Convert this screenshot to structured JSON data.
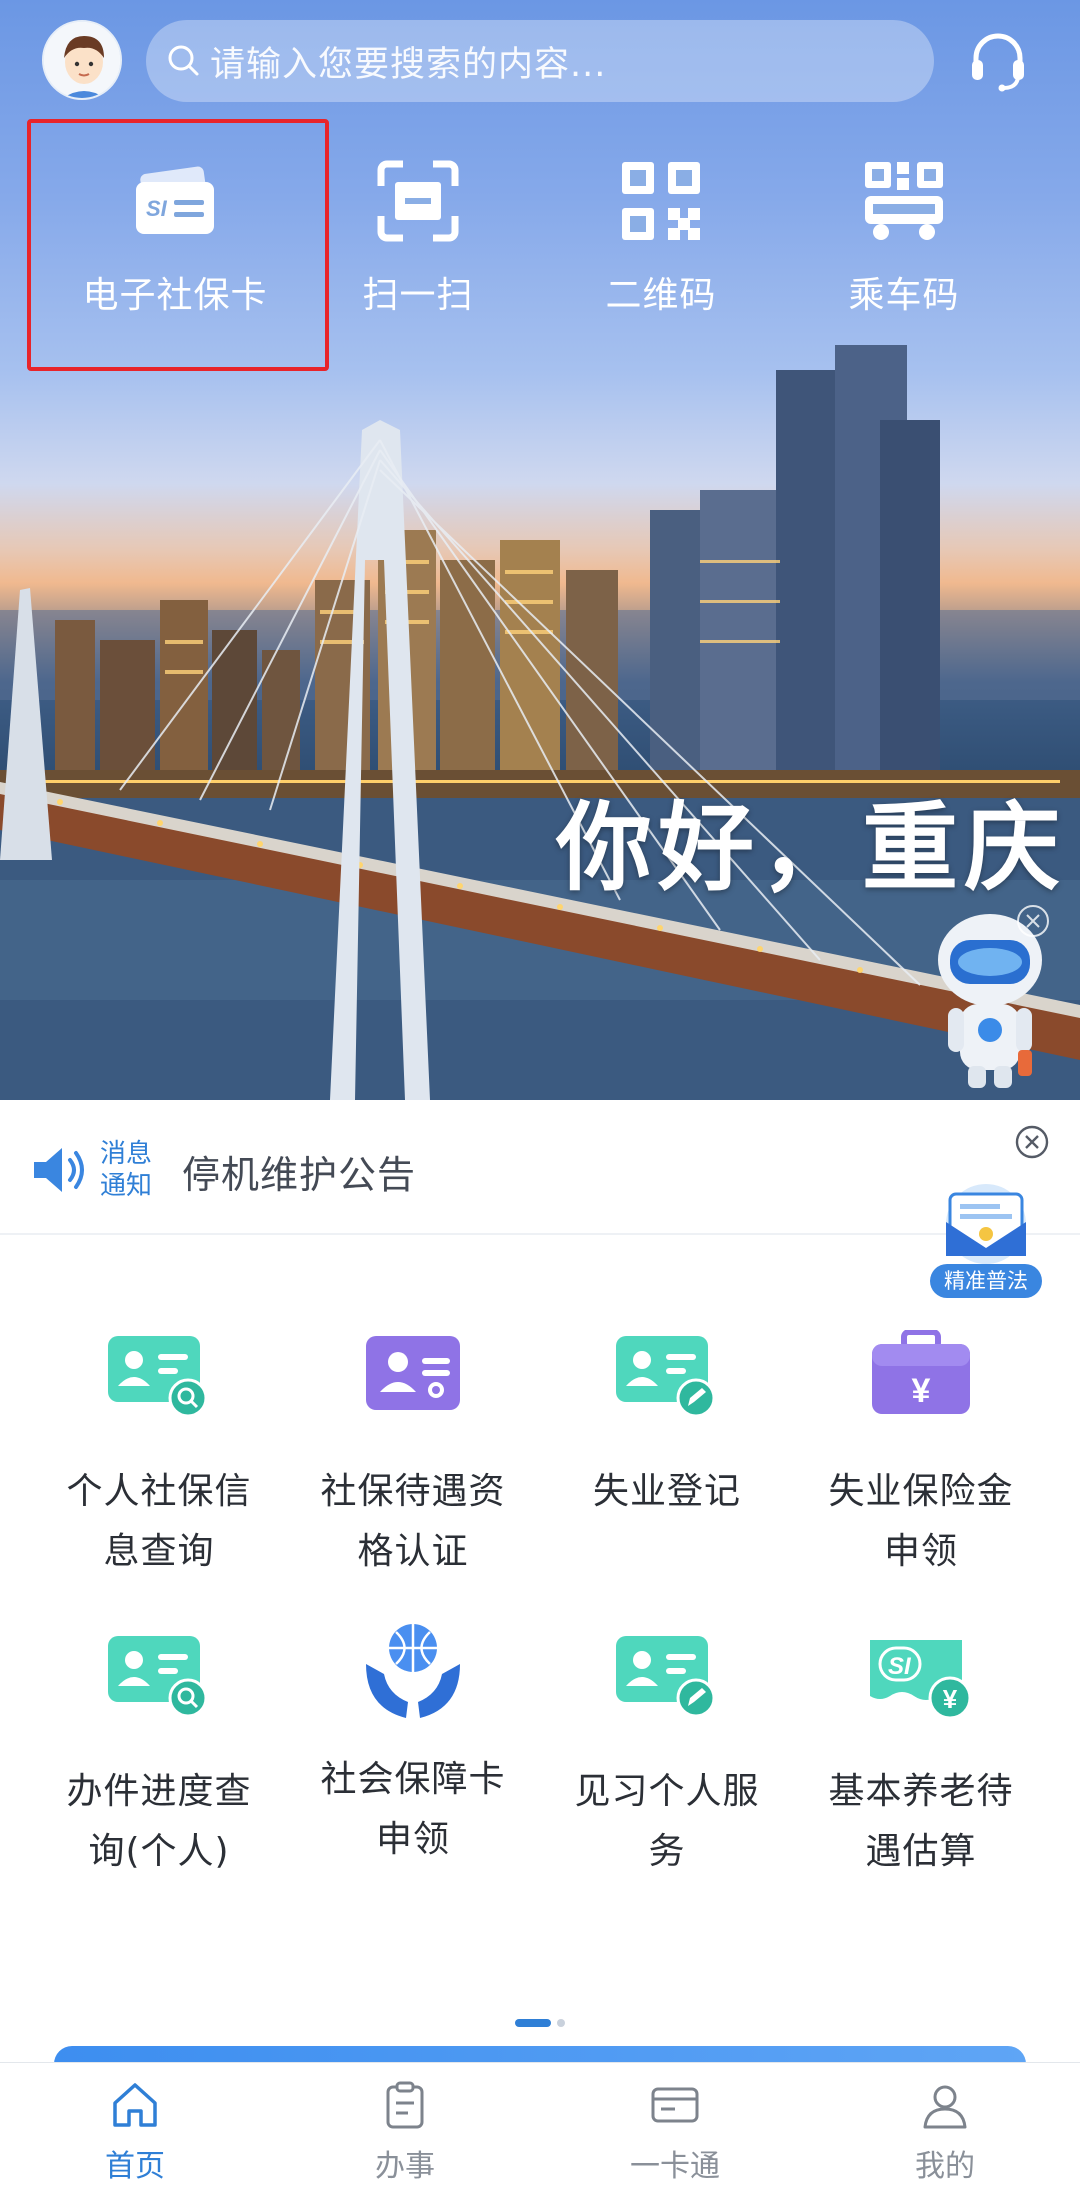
{
  "search": {
    "placeholder": "请输入您要搜索的内容..."
  },
  "quick_actions": [
    {
      "label": "电子社保卡",
      "icon": "social-security-card-icon",
      "highlighted": true
    },
    {
      "label": "扫一扫",
      "icon": "scan-icon"
    },
    {
      "label": "二维码",
      "icon": "qr-code-icon"
    },
    {
      "label": "乘车码",
      "icon": "bus-code-icon"
    }
  ],
  "banner": {
    "greeting": "你好，重庆"
  },
  "notice": {
    "tag_line1": "消息",
    "tag_line2": "通知",
    "text": "停机维护公告"
  },
  "float_badge": {
    "label": "精准普法"
  },
  "services": [
    {
      "line1": "个人社保信",
      "line2": "息查询",
      "icon": "id-card-search-icon"
    },
    {
      "line1": "社保待遇资",
      "line2": "格认证",
      "icon": "certificate-icon"
    },
    {
      "line1": "失业登记",
      "line2": "",
      "icon": "id-card-edit-icon"
    },
    {
      "line1": "失业保险金",
      "line2": "申领",
      "icon": "briefcase-yuan-icon"
    },
    {
      "line1": "办件进度查",
      "line2": "询(个人)",
      "icon": "id-card-search-icon"
    },
    {
      "line1": "社会保障卡",
      "line2": "申领",
      "icon": "globe-hands-icon"
    },
    {
      "line1": "见习个人服",
      "line2": "务",
      "icon": "id-card-edit-icon"
    },
    {
      "line1": "基本养老待",
      "line2": "遇估算",
      "icon": "si-card-yuan-icon"
    }
  ],
  "pagination": {
    "current": 1,
    "total": 2
  },
  "tabs": [
    {
      "label": "首页",
      "icon": "home-icon",
      "active": true
    },
    {
      "label": "办事",
      "icon": "clipboard-icon",
      "active": false
    },
    {
      "label": "一卡通",
      "icon": "card-icon",
      "active": false
    },
    {
      "label": "我的",
      "icon": "user-icon",
      "active": false
    }
  ],
  "colors": {
    "accent": "#2f7fd6",
    "highlight_border": "#e8242a",
    "teal": "#3fcfb5",
    "purple": "#8b6fe0"
  }
}
